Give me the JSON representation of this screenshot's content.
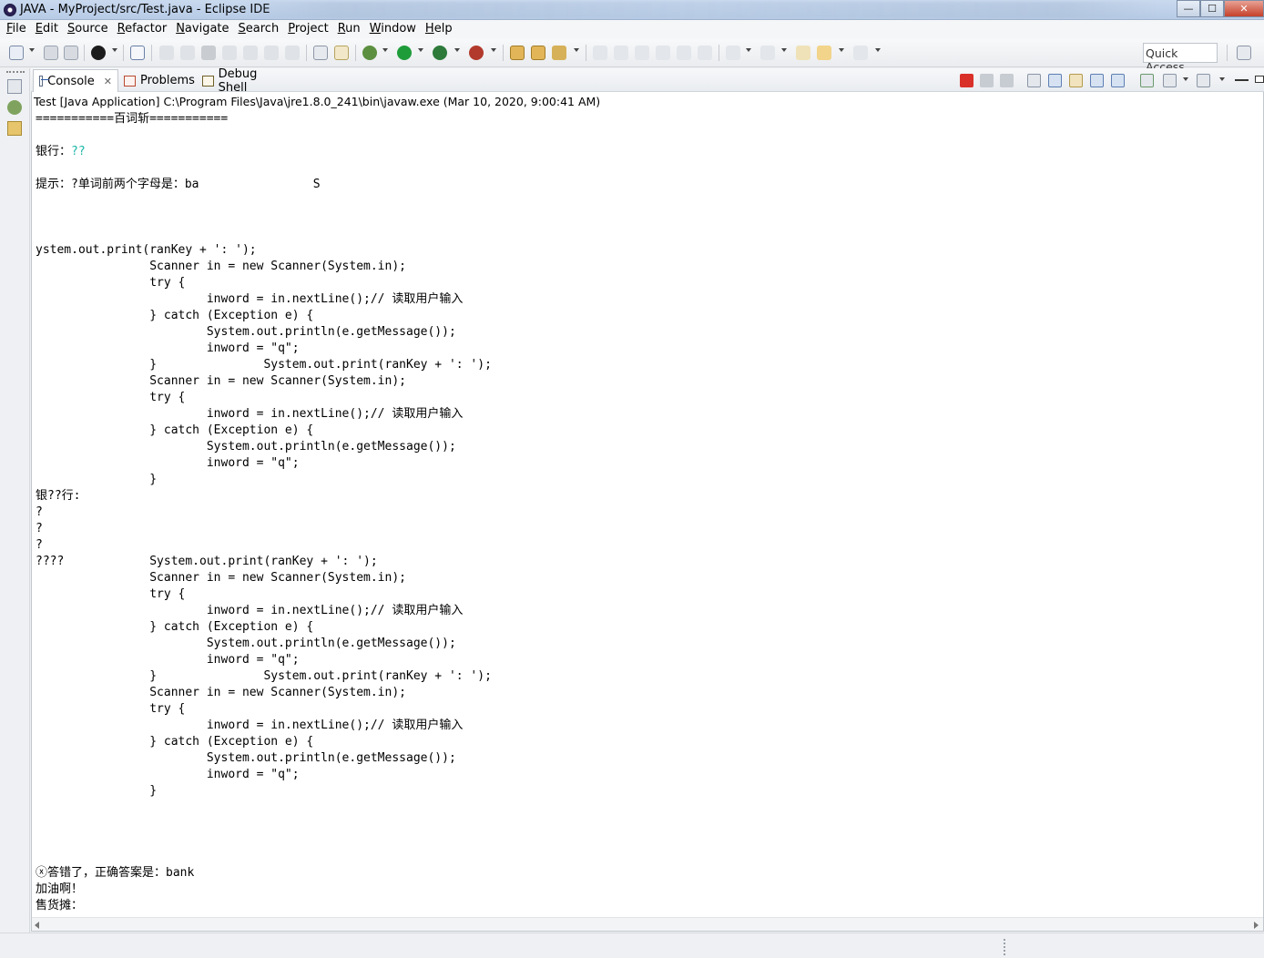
{
  "window": {
    "title": "JAVA - MyProject/src/Test.java - Eclipse IDE",
    "minimize": "—",
    "maximize": "☐",
    "close": "✕"
  },
  "menu": [
    {
      "label": "File"
    },
    {
      "label": "Edit"
    },
    {
      "label": "Source"
    },
    {
      "label": "Refactor"
    },
    {
      "label": "Navigate"
    },
    {
      "label": "Search"
    },
    {
      "label": "Project"
    },
    {
      "label": "Run"
    },
    {
      "label": "Window"
    },
    {
      "label": "Help"
    }
  ],
  "toolbar": {
    "quick_access": "Quick Access"
  },
  "tabs": [
    {
      "label": "Console",
      "close": "✕"
    },
    {
      "label": "Problems"
    },
    {
      "label": "Debug Shell"
    }
  ],
  "console": {
    "process_label": "Test [Java Application] C:\\Program Files\\Java\\jre1.8.0_241\\bin\\javaw.exe (Mar 10, 2020, 9:00:41 AM)",
    "lines": [
      "===========百词斩===========",
      "",
      "银行：",
      "",
      "提示：?单词前两个字母是：ba                S",
      "",
      "",
      "",
      "ystem.out.print(ranKey + ': ');",
      "                Scanner in = new Scanner(System.in);",
      "                try {",
      "                        inword = in.nextLine();// 读取用户输入",
      "                } catch (Exception e) {",
      "                        System.out.println(e.getMessage());",
      "                        inword = \"q\";",
      "                }               System.out.print(ranKey + ': ');",
      "                Scanner in = new Scanner(System.in);",
      "                try {",
      "                        inword = in.nextLine();// 读取用户输入",
      "                } catch (Exception e) {",
      "                        System.out.println(e.getMessage());",
      "                        inword = \"q\";",
      "                }",
      "银??行:",
      "?",
      "?",
      "?",
      "????            System.out.print(ranKey + ': ');",
      "                Scanner in = new Scanner(System.in);",
      "                try {",
      "                        inword = in.nextLine();// 读取用户输入",
      "                } catch (Exception e) {",
      "                        System.out.println(e.getMessage());",
      "                        inword = \"q\";",
      "                }               System.out.print(ranKey + ': ');",
      "                Scanner in = new Scanner(System.in);",
      "                try {",
      "                        inword = in.nextLine();// 读取用户输入",
      "                } catch (Exception e) {",
      "                        System.out.println(e.getMessage());",
      "                        inword = \"q\";",
      "                }",
      "",
      "",
      "",
      "",
      "ⓧ答错了，正确答案是：bank",
      "加油啊！",
      "售货摊："
    ],
    "input_echo": "??",
    "input_color": "#1bb7a7"
  }
}
